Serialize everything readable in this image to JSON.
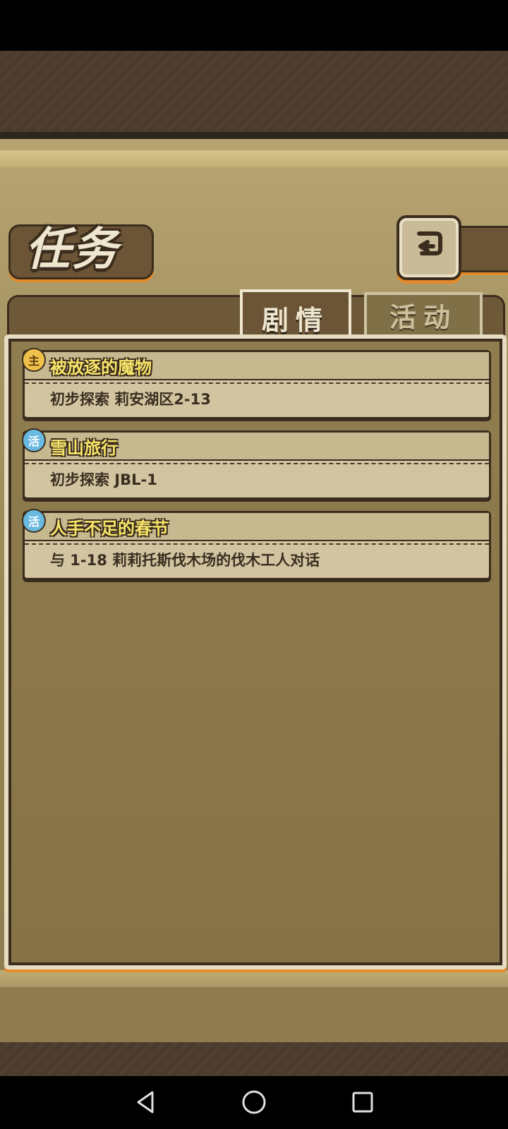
{
  "header": {
    "title": "任务",
    "back_icon": "return-arrow-icon"
  },
  "tabs": [
    {
      "label": "剧情",
      "active": true
    },
    {
      "label": "活动",
      "active": false
    }
  ],
  "quests": [
    {
      "badge": "主",
      "badge_type": "main",
      "title": "被放逐的魔物",
      "description": "初步探索 莉安湖区2-13"
    },
    {
      "badge": "活",
      "badge_type": "event",
      "title": "雪山旅行",
      "description": "初步探索 JBL-1"
    },
    {
      "badge": "活",
      "badge_type": "event",
      "title": "人手不足的春节",
      "description": "与 1-18 莉莉托斯伐木场的伐木工人对话"
    }
  ],
  "navbar": {
    "back_icon": "nav-back-icon",
    "home_icon": "nav-home-icon",
    "recents_icon": "nav-recents-icon"
  },
  "colors": {
    "accent_orange": "#e38a2a",
    "quest_title": "#f7e46a",
    "parchment": "#a99766"
  }
}
